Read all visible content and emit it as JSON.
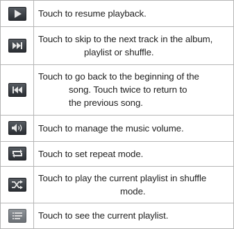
{
  "rows": [
    {
      "icon": "play-icon",
      "line1": "Touch to resume playback.",
      "line2": "",
      "line3": ""
    },
    {
      "icon": "next-track-icon",
      "line1": "Touch to skip to the next track in the album,",
      "line2": "playlist or shuffle.",
      "line3": ""
    },
    {
      "icon": "previous-track-icon",
      "line1": "Touch to go back to the beginning of the",
      "line2": "song. Touch twice to return to",
      "line3": "the previous song."
    },
    {
      "icon": "volume-icon",
      "line1": "Touch to manage the music volume.",
      "line2": "",
      "line3": ""
    },
    {
      "icon": "repeat-icon",
      "line1": "Touch to set repeat mode.",
      "line2": "",
      "line3": ""
    },
    {
      "icon": "shuffle-icon",
      "line1": "Touch to play the current playlist in shuffle",
      "line2": "mode.",
      "line3": ""
    },
    {
      "icon": "playlist-icon",
      "line1": "Touch to see the current playlist.",
      "line2": "",
      "line3": ""
    }
  ]
}
